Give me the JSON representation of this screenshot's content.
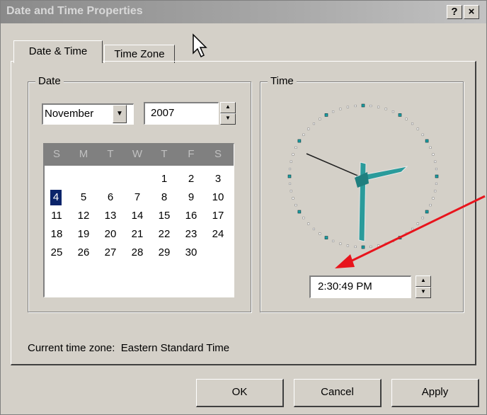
{
  "window": {
    "title": "Date and Time Properties",
    "help_label": "?",
    "close_label": "×"
  },
  "tabs": [
    {
      "label": "Date & Time",
      "active": true
    },
    {
      "label": "Time Zone",
      "active": false
    }
  ],
  "date_group": {
    "label": "Date",
    "month": "November",
    "year": "2007",
    "weekdays": [
      "S",
      "M",
      "T",
      "W",
      "T",
      "F",
      "S"
    ],
    "weeks": [
      [
        "",
        "",
        "",
        "",
        "1",
        "2",
        "3"
      ],
      [
        "4",
        "5",
        "6",
        "7",
        "8",
        "9",
        "10"
      ],
      [
        "11",
        "12",
        "13",
        "14",
        "15",
        "16",
        "17"
      ],
      [
        "18",
        "19",
        "20",
        "21",
        "22",
        "23",
        "24"
      ],
      [
        "25",
        "26",
        "27",
        "28",
        "29",
        "30",
        ""
      ]
    ],
    "selected_day": "4"
  },
  "time_group": {
    "label": "Time",
    "time_value": "2:30:49 PM"
  },
  "timezone_text": "Current time zone:  Eastern Standard Time",
  "buttons": {
    "ok": "OK",
    "cancel": "Cancel",
    "apply": "Apply"
  },
  "colors": {
    "dialog_bg": "#d4d0c8",
    "clock_hand": "#2a9b9b",
    "selected_day_bg": "#0a246a",
    "annotation_arrow": "#e8141c"
  }
}
